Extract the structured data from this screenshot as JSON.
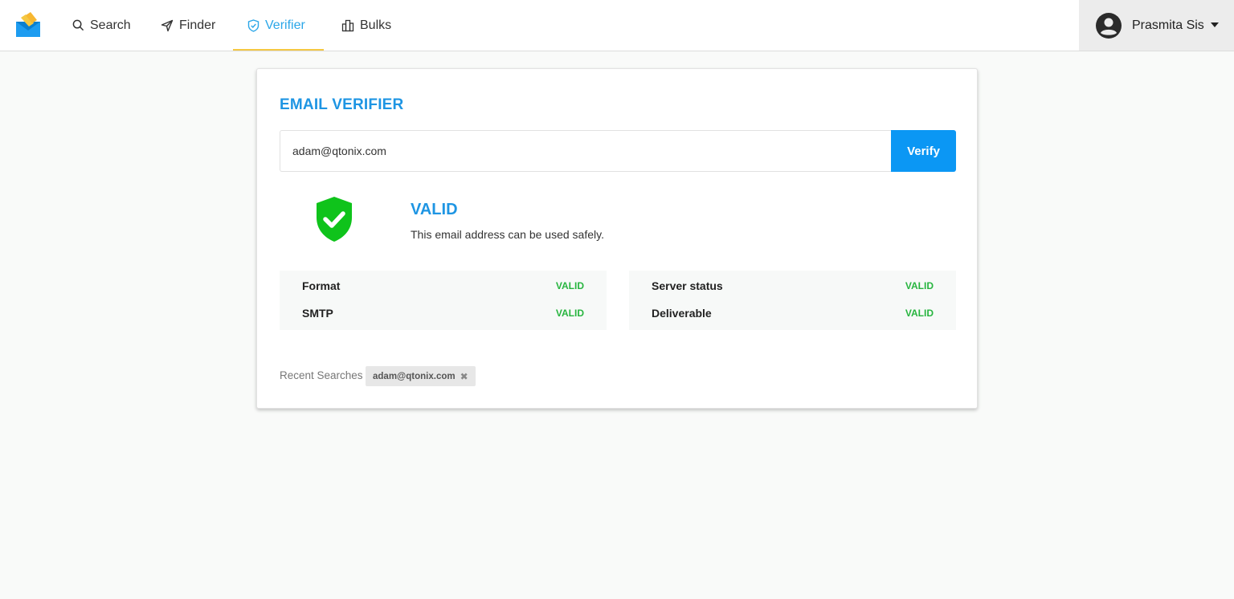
{
  "nav": {
    "items": [
      {
        "label": "Search",
        "icon": "search-icon"
      },
      {
        "label": "Finder",
        "icon": "send-icon"
      },
      {
        "label": "Verifier",
        "icon": "shield-icon",
        "active": true
      },
      {
        "label": "Bulks",
        "icon": "buildings-icon"
      }
    ],
    "accent_color": "#2aa6e8",
    "underline_color": "#f5c842"
  },
  "user": {
    "name": "Prasmita Sis",
    "icon": "user-avatar-icon"
  },
  "verifier": {
    "title": "EMAIL VERIFIER",
    "email_value": "adam@qtonix.com",
    "verify_label": "Verify",
    "result": {
      "status": "VALID",
      "description": "This email address can be used safely.",
      "icon": "shield-check-icon",
      "color": "#0fc31b"
    },
    "checks_left": [
      {
        "label": "Format",
        "value": "VALID"
      },
      {
        "label": "SMTP",
        "value": "VALID"
      }
    ],
    "checks_right": [
      {
        "label": "Server status",
        "value": "VALID"
      },
      {
        "label": "Deliverable",
        "value": "VALID"
      }
    ],
    "recent": {
      "label": "Recent Searches",
      "items": [
        "adam@qtonix.com"
      ]
    }
  }
}
